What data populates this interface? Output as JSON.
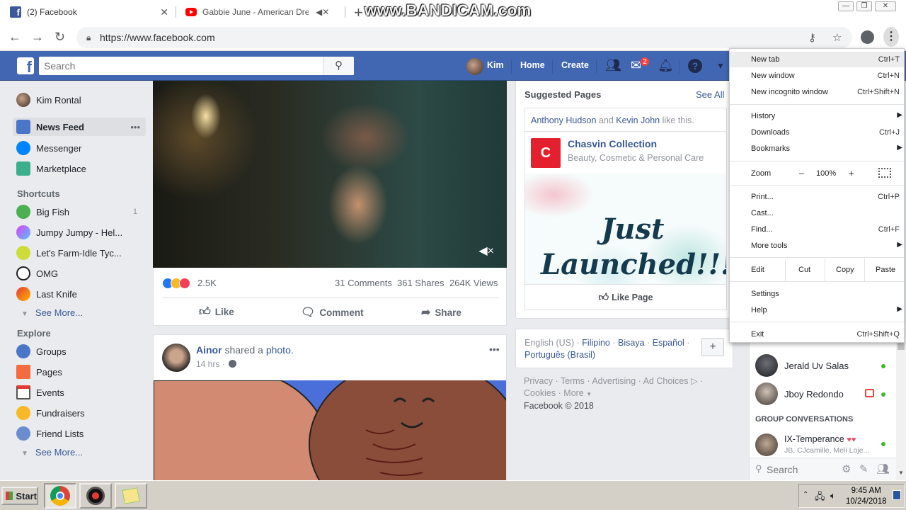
{
  "browser": {
    "tabs": [
      {
        "title": "(2) Facebook",
        "close": "✕"
      },
      {
        "title": "Gabbie June - American Dream"
      }
    ],
    "watermark": "www.BANDICAM.com",
    "url": "https://www.facebook.com"
  },
  "fb": {
    "search_placeholder": "Search",
    "user_name": "Kim",
    "nav": {
      "home": "Home",
      "create": "Create"
    },
    "messages_badge": "2"
  },
  "left_nav": {
    "profile": "Kim Rontal",
    "main": [
      {
        "label": "News Feed",
        "more": "•••"
      },
      {
        "label": "Messenger"
      },
      {
        "label": "Marketplace"
      }
    ],
    "shortcuts_title": "Shortcuts",
    "shortcuts": [
      {
        "label": "Big Fish",
        "count": "1"
      },
      {
        "label": "Jumpy Jumpy - Hel..."
      },
      {
        "label": "Let's Farm-Idle Tyc..."
      },
      {
        "label": "OMG"
      },
      {
        "label": "Last Knife"
      }
    ],
    "see_more": "See More...",
    "explore_title": "Explore",
    "explore": [
      {
        "label": "Groups"
      },
      {
        "label": "Pages"
      },
      {
        "label": "Events"
      },
      {
        "label": "Fundraisers"
      },
      {
        "label": "Friend Lists"
      }
    ]
  },
  "post1": {
    "reactions_count": "2.5K",
    "comments": "31 Comments",
    "shares": "361 Shares",
    "views": "264K Views",
    "actions": {
      "like": "Like",
      "comment": "Comment",
      "share": "Share"
    }
  },
  "post2": {
    "author": "Ainor",
    "shared": "shared a",
    "object": "photo.",
    "time": "14 hrs ·",
    "more": "•••"
  },
  "suggested": {
    "title": "Suggested Pages",
    "see_all": "See All",
    "liker1": "Anthony Hudson",
    "and": "and",
    "liker2": "Kevin John",
    "like_this": "like this.",
    "page_name": "Chasvin Collection",
    "page_category": "Beauty, Cosmetic & Personal Care",
    "promo_text": "Just Launched!!!",
    "like_page": "Like Page"
  },
  "languages": {
    "current": "English (US)",
    "options": [
      "Filipino",
      "Bisaya",
      "Español",
      "Português (Brasil)"
    ],
    "add": "+"
  },
  "footer": {
    "links": [
      "Privacy",
      "Terms",
      "Advertising",
      "Ad Choices",
      "Cookies",
      "More"
    ],
    "copyright": "Facebook © 2018"
  },
  "chat": {
    "contacts": [
      {
        "name": "Jerald Uv Salas"
      },
      {
        "name": "Jboy Redondo"
      }
    ],
    "group_title": "GROUP CONVERSATIONS",
    "group": {
      "name": "IX-Temperance",
      "members": "JB, CJcamille, Meli Loje..."
    },
    "search_placeholder": "Search"
  },
  "chrome_menu": {
    "new_tab": {
      "label": "New tab",
      "shortcut": "Ctrl+T"
    },
    "new_window": {
      "label": "New window",
      "shortcut": "Ctrl+N"
    },
    "incognito": {
      "label": "New incognito window",
      "shortcut": "Ctrl+Shift+N"
    },
    "history": {
      "label": "History"
    },
    "downloads": {
      "label": "Downloads",
      "shortcut": "Ctrl+J"
    },
    "bookmarks": {
      "label": "Bookmarks"
    },
    "zoom": {
      "label": "Zoom",
      "minus": "–",
      "value": "100%",
      "plus": "+"
    },
    "print": {
      "label": "Print...",
      "shortcut": "Ctrl+P"
    },
    "cast": {
      "label": "Cast..."
    },
    "find": {
      "label": "Find...",
      "shortcut": "Ctrl+F"
    },
    "more_tools": {
      "label": "More tools"
    },
    "edit": {
      "label": "Edit",
      "cut": "Cut",
      "copy": "Copy",
      "paste": "Paste"
    },
    "settings": {
      "label": "Settings"
    },
    "help": {
      "label": "Help"
    },
    "exit": {
      "label": "Exit",
      "shortcut": "Ctrl+Shift+Q"
    }
  },
  "taskbar": {
    "start": "Start",
    "time": "9:45 AM",
    "date": "10/24/2018"
  },
  "colors": {
    "fb_blue": "#4267b2",
    "link": "#385898",
    "notification": "#fa3e3e",
    "online": "#42b72a"
  }
}
